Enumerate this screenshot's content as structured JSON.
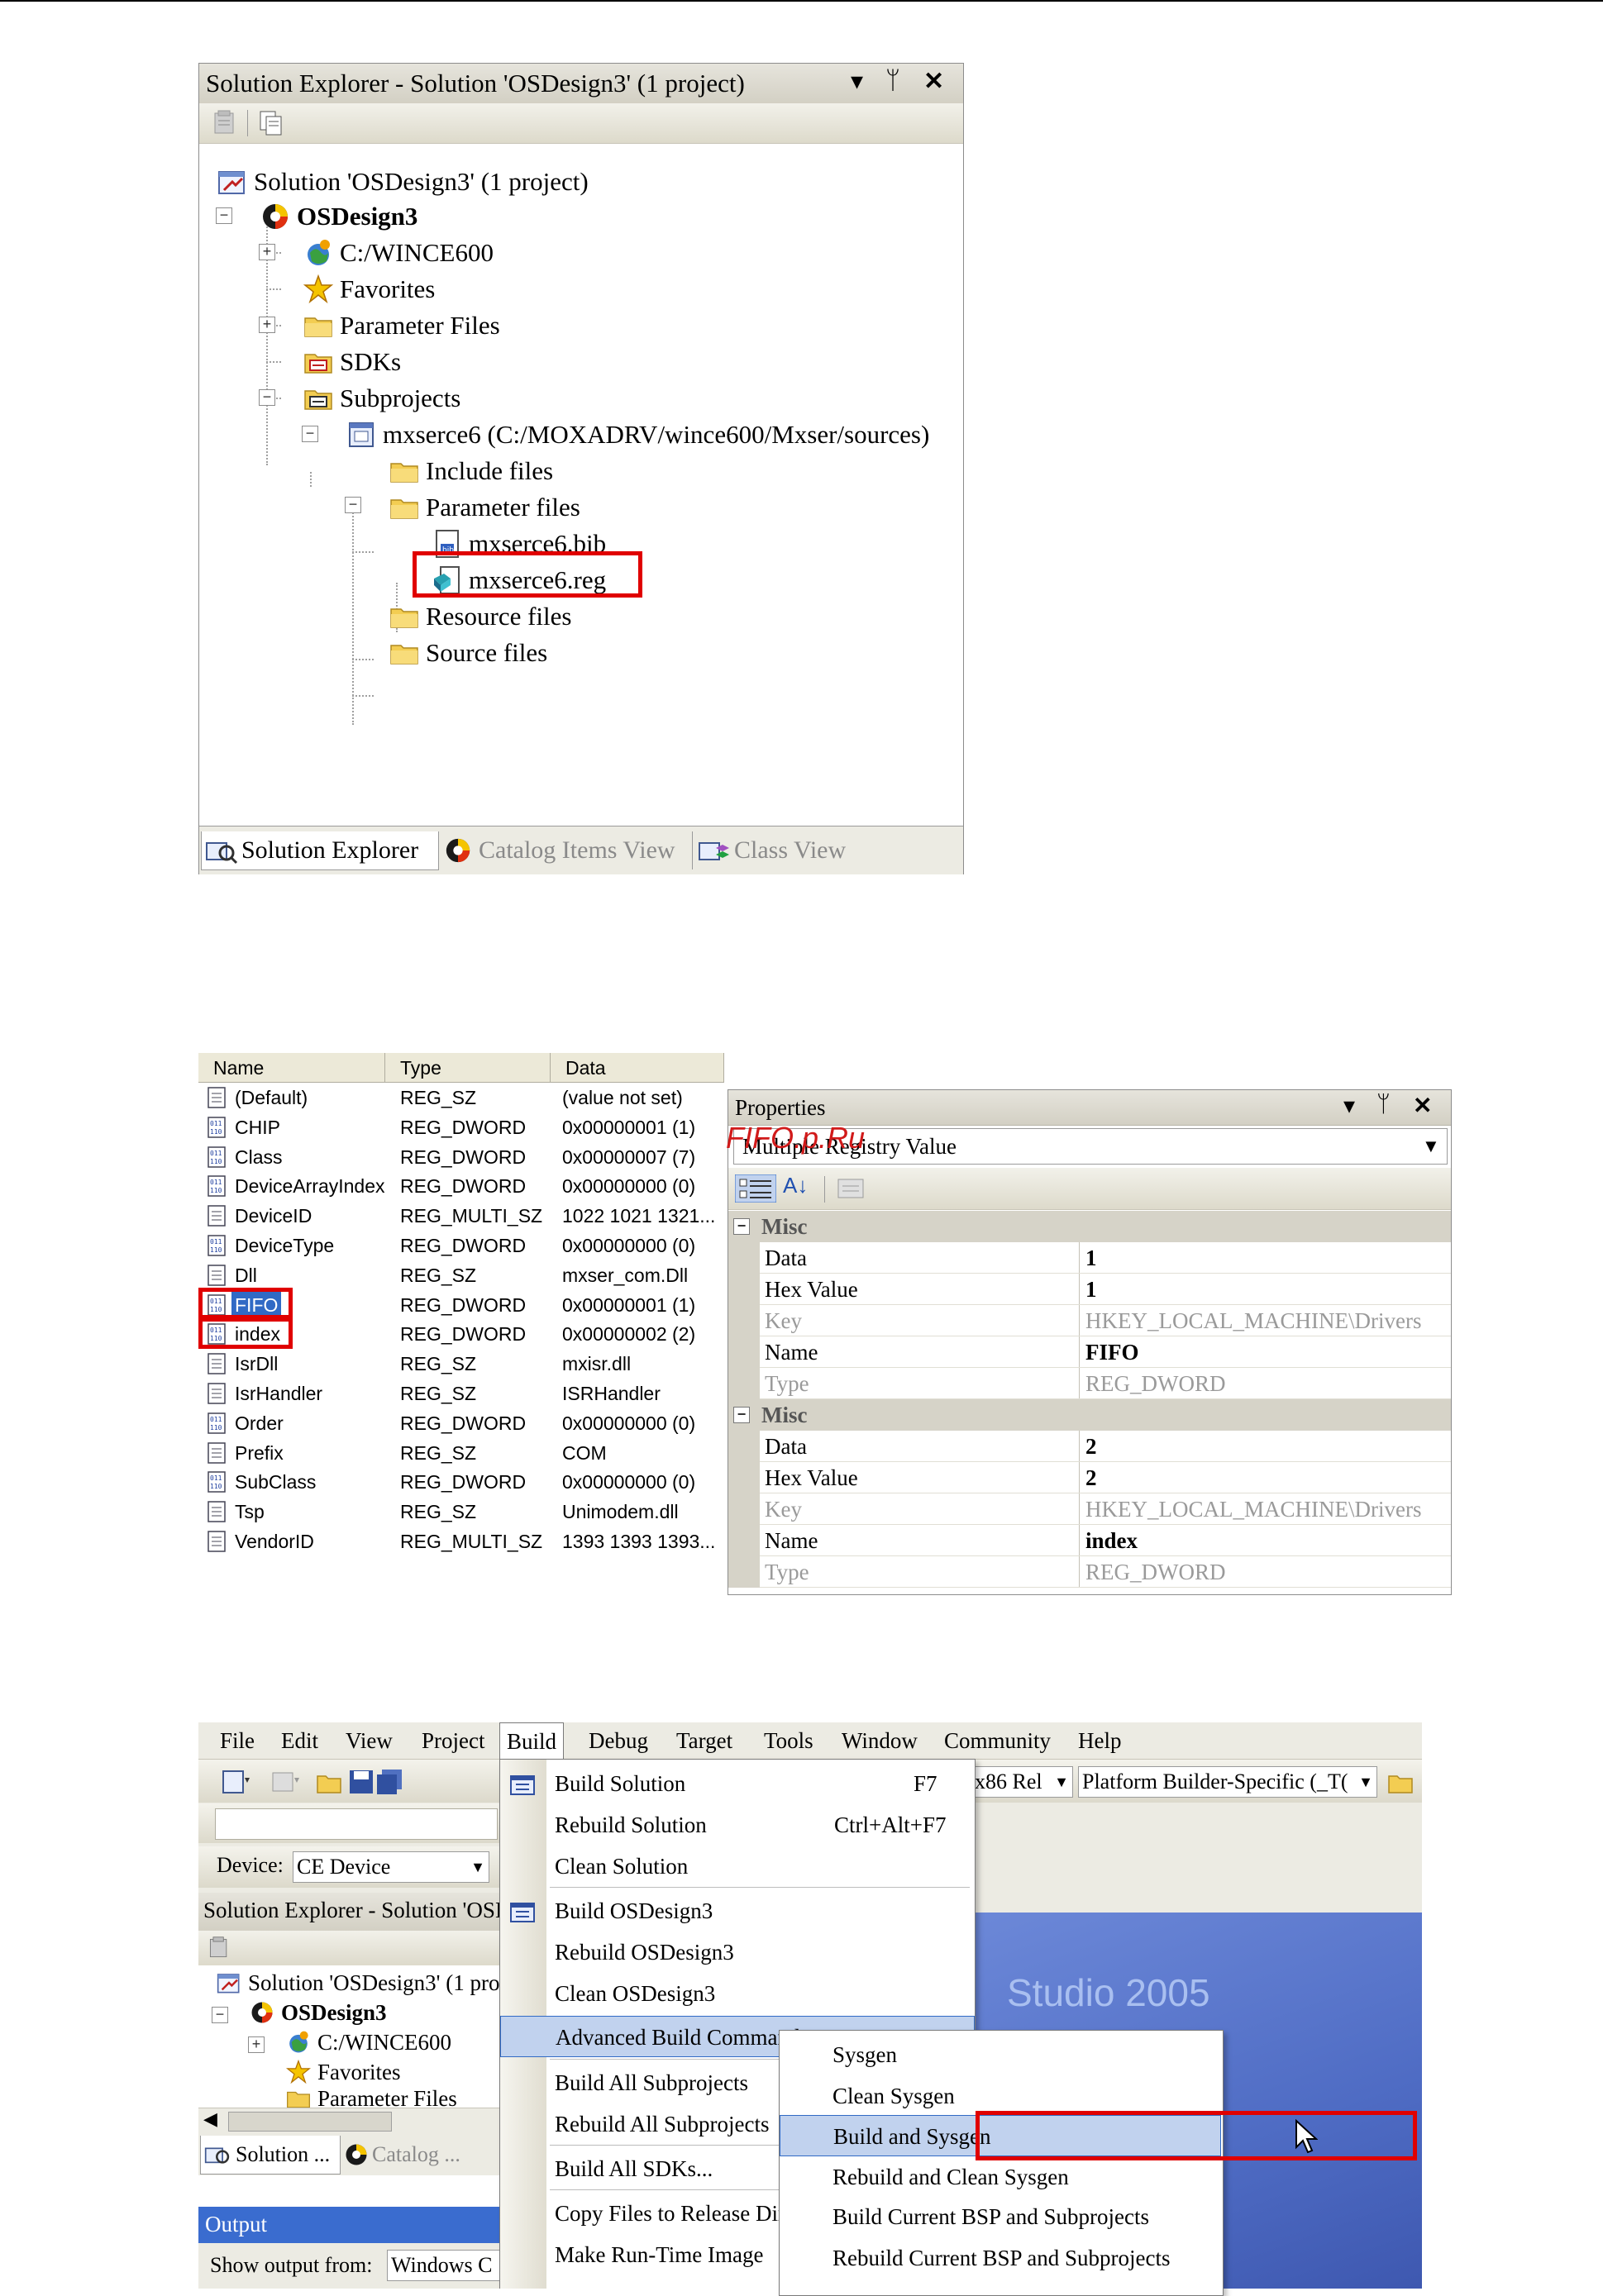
{
  "solution_explorer": {
    "title": "Solution Explorer - Solution 'OSDesign3' (1 project)",
    "tree": {
      "solution": "Solution 'OSDesign3' (1 project)",
      "project": "OSDesign3",
      "wince": "C:/WINCE600",
      "favorites": "Favorites",
      "parameter_files": "Parameter Files",
      "sdks": "SDKs",
      "subprojects": "Subprojects",
      "subproject": "mxserce6 (C:/MOXADRV/wince600/Mxser/sources)",
      "include_files": "Include files",
      "sub_parameter_files": "Parameter files",
      "bib": "mxserce6.bib",
      "reg": "mxserce6.reg",
      "resource_files": "Resource files",
      "source_files": "Source files"
    },
    "tabs": [
      "Solution Explorer",
      "Catalog Items View",
      "Class View"
    ]
  },
  "registry": {
    "headers": [
      "Name",
      "Type",
      "Data"
    ],
    "rows": [
      {
        "name": "(Default)",
        "type": "REG_SZ",
        "data": "(value not set)",
        "icon": "string-value-icon"
      },
      {
        "name": "CHIP",
        "type": "REG_DWORD",
        "data": "0x00000001 (1)",
        "icon": "binary-value-icon"
      },
      {
        "name": "Class",
        "type": "REG_DWORD",
        "data": "0x00000007 (7)",
        "icon": "binary-value-icon"
      },
      {
        "name": "DeviceArrayIndex",
        "type": "REG_DWORD",
        "data": "0x00000000 (0)",
        "icon": "binary-value-icon"
      },
      {
        "name": "DeviceID",
        "type": "REG_MULTI_SZ",
        "data": "1022 1021 1321...",
        "icon": "string-value-icon"
      },
      {
        "name": "DeviceType",
        "type": "REG_DWORD",
        "data": "0x00000000 (0)",
        "icon": "binary-value-icon"
      },
      {
        "name": "Dll",
        "type": "REG_SZ",
        "data": "mxser_com.Dll",
        "icon": "string-value-icon"
      },
      {
        "name": "FIFO",
        "type": "REG_DWORD",
        "data": "0x00000001 (1)",
        "icon": "binary-value-icon",
        "selected": true
      },
      {
        "name": "index",
        "type": "REG_DWORD",
        "data": "0x00000002 (2)",
        "icon": "binary-value-icon"
      },
      {
        "name": "IsrDll",
        "type": "REG_SZ",
        "data": "mxisr.dll",
        "icon": "string-value-icon"
      },
      {
        "name": "IsrHandler",
        "type": "REG_SZ",
        "data": "ISRHandler",
        "icon": "string-value-icon"
      },
      {
        "name": "Order",
        "type": "REG_DWORD",
        "data": "0x00000000 (0)",
        "icon": "binary-value-icon"
      },
      {
        "name": "Prefix",
        "type": "REG_SZ",
        "data": "COM",
        "icon": "string-value-icon"
      },
      {
        "name": "SubClass",
        "type": "REG_DWORD",
        "data": "0x00000000 (0)",
        "icon": "binary-value-icon"
      },
      {
        "name": "Tsp",
        "type": "REG_SZ",
        "data": "Unimodem.dll",
        "icon": "string-value-icon"
      },
      {
        "name": "VendorID",
        "type": "REG_MULTI_SZ",
        "data": "1393 1393 1393...",
        "icon": "string-value-icon"
      }
    ]
  },
  "properties": {
    "title": "Properties",
    "object": "Multiple Registry Value",
    "watermark": "FIFO.p.Ru",
    "groups": [
      {
        "category": "Misc",
        "rows": [
          {
            "name": "Data",
            "value": "1",
            "disabled": false
          },
          {
            "name": "Hex Value",
            "value": "1",
            "disabled": false
          },
          {
            "name": "Key",
            "value": "HKEY_LOCAL_MACHINE\\Drivers",
            "disabled": true
          },
          {
            "name": "Name",
            "value": "FIFO",
            "disabled": false
          },
          {
            "name": "Type",
            "value": "REG_DWORD",
            "disabled": true
          }
        ]
      },
      {
        "category": "Misc",
        "rows": [
          {
            "name": "Data",
            "value": "2",
            "disabled": false
          },
          {
            "name": "Hex Value",
            "value": "2",
            "disabled": false
          },
          {
            "name": "Key",
            "value": "HKEY_LOCAL_MACHINE\\Drivers",
            "disabled": true
          },
          {
            "name": "Name",
            "value": "index",
            "disabled": false
          },
          {
            "name": "Type",
            "value": "REG_DWORD",
            "disabled": true
          }
        ]
      }
    ]
  },
  "ide": {
    "menubar": [
      "File",
      "Edit",
      "View",
      "Project",
      "Build",
      "Debug",
      "Target",
      "Tools",
      "Window",
      "Community",
      "Help"
    ],
    "config_combo": "x86 Rel",
    "platform_combo": "Platform Builder-Specific (_T(",
    "device_label": "Device:",
    "device_value": "CE Device",
    "se_title": "Solution Explorer - Solution 'OSI",
    "se_solution": "Solution 'OSDesign3' (1 pro",
    "se_project": "OSDesign3",
    "se_wince": "C:/WINCE600",
    "se_favorites": "Favorites",
    "se_parameter_files": "Parameter Files",
    "se_tab1": "Solution ...",
    "se_tab2": "Catalog ...",
    "output_title": "Output",
    "output_show_label": "Show output from:",
    "output_show_value": "Windows C",
    "bg_text": "Studio 2005"
  },
  "build_menu": {
    "items": [
      {
        "label": "Build Solution",
        "shortcut": "F7"
      },
      {
        "label": "Rebuild Solution",
        "shortcut": "Ctrl+Alt+F7"
      },
      {
        "label": "Clean Solution",
        "shortcut": ""
      },
      {
        "label": "Build OSDesign3",
        "shortcut": ""
      },
      {
        "label": "Rebuild OSDesign3",
        "shortcut": ""
      },
      {
        "label": "Clean OSDesign3",
        "shortcut": ""
      },
      {
        "label": "Advanced Build Commands",
        "shortcut": ""
      },
      {
        "label": "Build All Subprojects",
        "shortcut": ""
      },
      {
        "label": "Rebuild All Subprojects",
        "shortcut": ""
      },
      {
        "label": "Build All SDKs...",
        "shortcut": ""
      },
      {
        "label": "Copy Files to Release Directory",
        "shortcut": ""
      },
      {
        "label": "Make Run-Time Image",
        "shortcut": ""
      }
    ]
  },
  "advanced_submenu": {
    "items": [
      "Sysgen",
      "Clean Sysgen",
      "Build and Sysgen",
      "Rebuild and Clean Sysgen",
      "Build Current BSP and Subprojects",
      "Rebuild Current BSP and Subprojects"
    ]
  }
}
